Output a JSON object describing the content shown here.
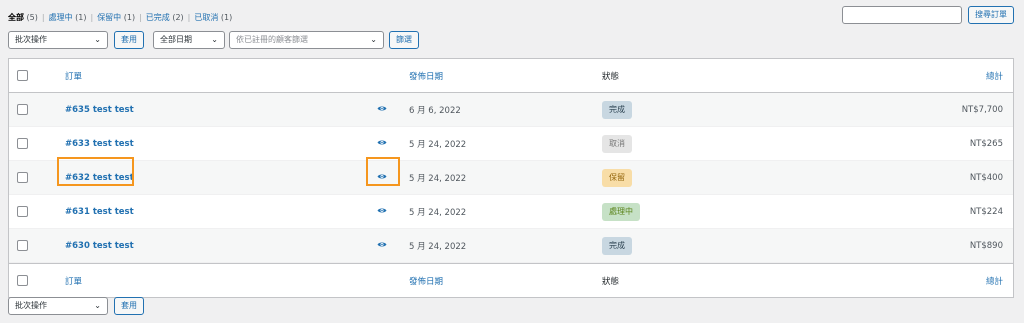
{
  "filters": [
    {
      "label": "全部",
      "count": "(5)",
      "current": true
    },
    {
      "label": "處理中",
      "count": "(1)"
    },
    {
      "label": "保留中",
      "count": "(1)"
    },
    {
      "label": "已完成",
      "count": "(2)"
    },
    {
      "label": "已取消",
      "count": "(1)"
    }
  ],
  "search": {
    "value": "",
    "button": "搜尋訂單"
  },
  "top_controls": {
    "bulk_action": "批次操作",
    "apply": "套用",
    "date_filter": "全部日期",
    "customer_placeholder": "依已註冊的顧客篩選",
    "filter_button": "篩選"
  },
  "columns": {
    "order": "訂單",
    "date": "發佈日期",
    "status": "狀態",
    "total": "總計"
  },
  "orders": [
    {
      "title": "#635 test test",
      "date": "6 月 6, 2022",
      "status": "完成",
      "status_bg": "#c8d7e1",
      "status_fg": "#2e4453",
      "total": "NT$7,700"
    },
    {
      "title": "#633 test test",
      "date": "5 月 24, 2022",
      "status": "取消",
      "status_bg": "#e5e5e5",
      "status_fg": "#777777",
      "total": "NT$265"
    },
    {
      "title": "#632 test test",
      "date": "5 月 24, 2022",
      "status": "保留",
      "status_bg": "#f8dda7",
      "status_fg": "#94660c",
      "total": "NT$400"
    },
    {
      "title": "#631 test test",
      "date": "5 月 24, 2022",
      "status": "處理中",
      "status_bg": "#c6e1c6",
      "status_fg": "#5b841b",
      "total": "NT$224"
    },
    {
      "title": "#630 test test",
      "date": "5 月 24, 2022",
      "status": "完成",
      "status_bg": "#c8d7e1",
      "status_fg": "#2e4453",
      "total": "NT$890"
    }
  ],
  "bottom_controls": {
    "bulk_action": "批次操作",
    "apply": "套用"
  },
  "icons": {
    "preview": "eye-icon",
    "dropdown": "chevron-down-icon"
  },
  "colors": {
    "highlight": "#f5961e",
    "link": "#2271b1"
  }
}
